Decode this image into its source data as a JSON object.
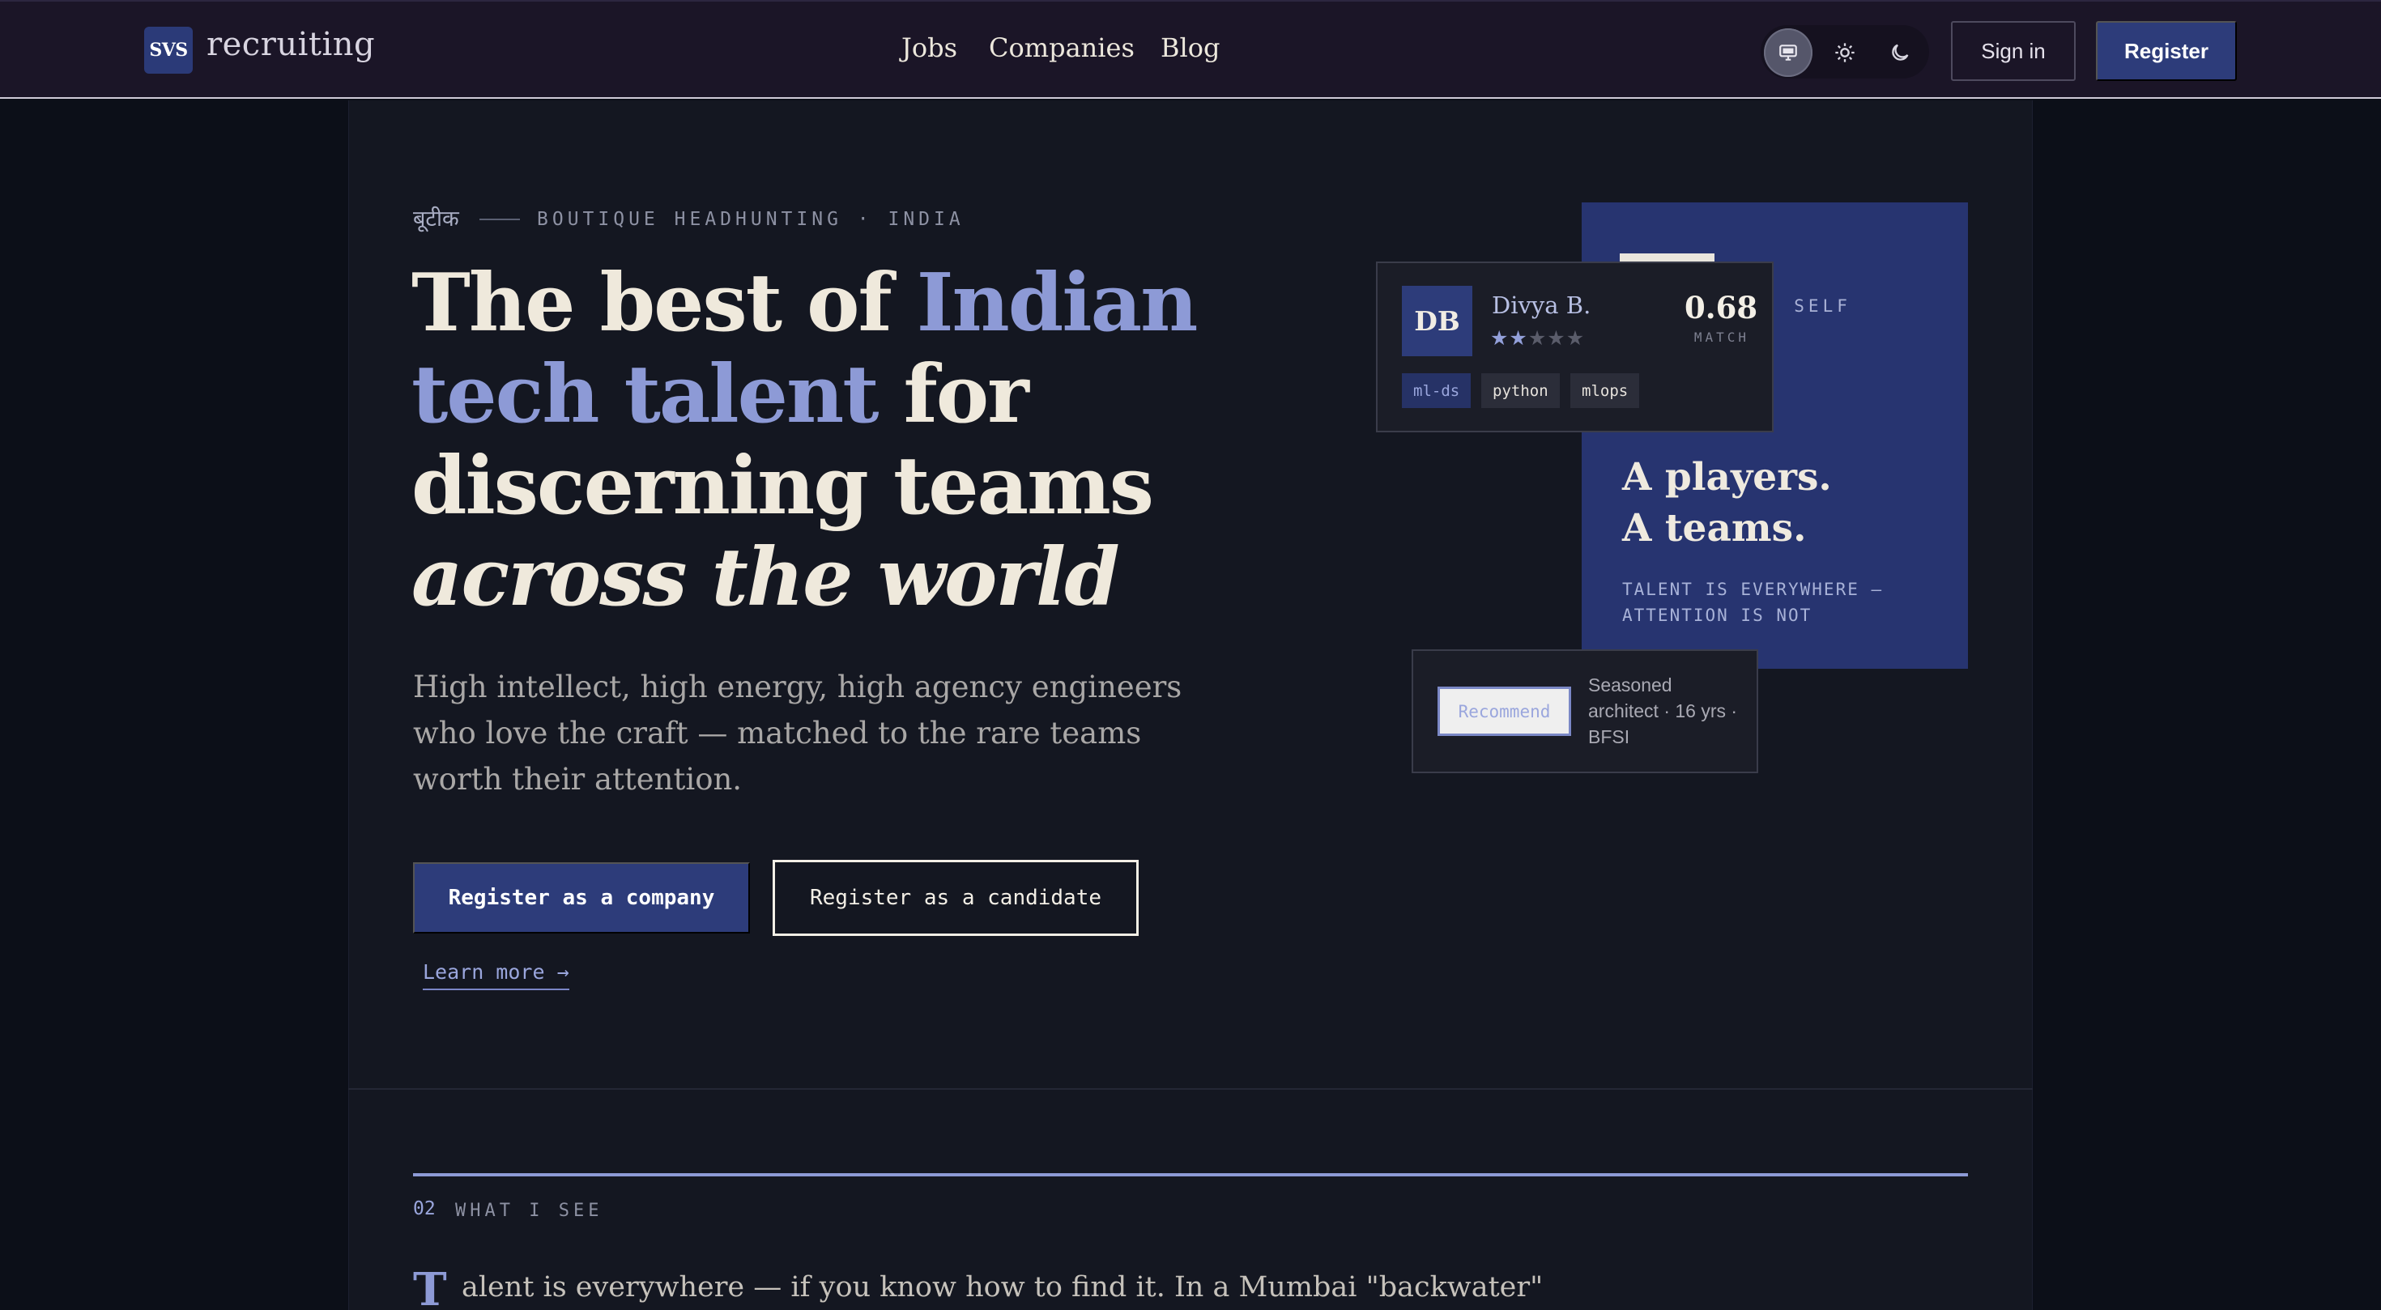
{
  "header": {
    "logo_mark": "SVS",
    "logo_text": "recruiting",
    "nav": [
      {
        "label": "Jobs"
      },
      {
        "label": "Companies"
      },
      {
        "label": "Blog"
      }
    ],
    "theme_options": [
      "system",
      "light",
      "dark"
    ],
    "theme_selected": "system",
    "sign_in_label": "Sign in",
    "register_label": "Register"
  },
  "hero": {
    "eyebrow_hindi": "बूटीक",
    "eyebrow_text": "BOUTIQUE HEADHUNTING · INDIA",
    "title_part1": "The best of ",
    "title_accent": "Indian tech talent",
    "title_part2": " for discerning teams ",
    "title_italic": "across the world",
    "subtitle": "High intellect, high energy, high agency engineers who love the craft — matched to the rare teams worth their attention.",
    "cta_company": "Register as a company",
    "cta_candidate": "Register as a candidate",
    "learn_more": "Learn more →"
  },
  "visual": {
    "panel_label": "· SELF",
    "panel_heading_line1": "A players.",
    "panel_heading_line2": "A teams.",
    "panel_tagline": "TALENT IS EVERYWHERE — ATTENTION IS NOT",
    "candidate": {
      "initials": "DB",
      "name": "Divya B.",
      "rating": 2,
      "rating_max": 5,
      "match_score": "0.68",
      "match_label": "MATCH",
      "tags": [
        "ml-ds",
        "python",
        "mlops"
      ]
    },
    "recommend": {
      "button_label": "Recommend",
      "description": "Seasoned architect · 16 yrs · BFSI"
    }
  },
  "section2": {
    "number": "02",
    "label": "WHAT I SEE",
    "dropcap": "T",
    "body": "alent is everywhere — if you know how to find it. In a Mumbai \"backwater\""
  },
  "colors": {
    "accent": "#8d9ad6",
    "brand_blue": "#2d3c7a",
    "background": "#141721",
    "header_bg": "#1b1527"
  }
}
